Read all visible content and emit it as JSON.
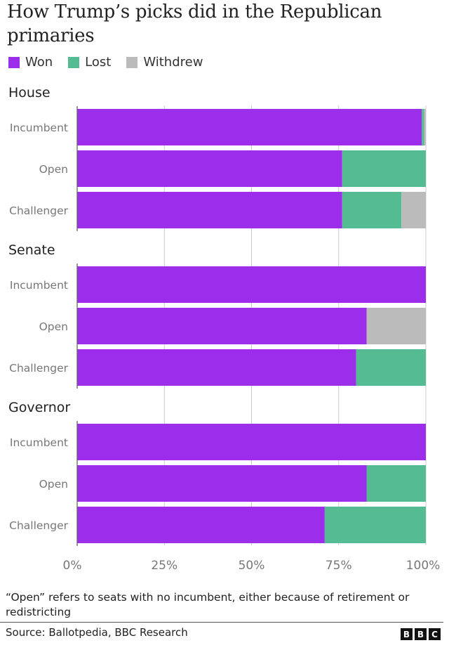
{
  "chart_data": {
    "type": "bar",
    "orientation": "horizontal",
    "stacked": true,
    "title": "How Trump’s picks did in the Republican primaries",
    "xlabel": "",
    "ylabel": "",
    "xlim": [
      0,
      100
    ],
    "x_ticks": [
      "0%",
      "25%",
      "50%",
      "75%",
      "100%"
    ],
    "x_tick_values": [
      0,
      25,
      50,
      75,
      100
    ],
    "grid": true,
    "legend_position": "top-left",
    "legend": [
      {
        "name": "Won",
        "color": "#9b2deb"
      },
      {
        "name": "Lost",
        "color": "#55bb92"
      },
      {
        "name": "Withdrew",
        "color": "#bbbbbb"
      }
    ],
    "groups": [
      {
        "name": "House",
        "categories": [
          "Incumbent",
          "Open",
          "Challenger"
        ],
        "series": [
          {
            "name": "Won",
            "values": [
              98.8,
              76,
              76
            ]
          },
          {
            "name": "Lost",
            "values": [
              0.7,
              24,
              17
            ]
          },
          {
            "name": "Withdrew",
            "values": [
              0.5,
              0,
              7
            ]
          }
        ]
      },
      {
        "name": "Senate",
        "categories": [
          "Incumbent",
          "Open",
          "Challenger"
        ],
        "series": [
          {
            "name": "Won",
            "values": [
              100,
              83,
              80
            ]
          },
          {
            "name": "Lost",
            "values": [
              0,
              0,
              20
            ]
          },
          {
            "name": "Withdrew",
            "values": [
              0,
              17,
              0
            ]
          }
        ]
      },
      {
        "name": "Governor",
        "categories": [
          "Incumbent",
          "Open",
          "Challenger"
        ],
        "series": [
          {
            "name": "Won",
            "values": [
              100,
              83,
              71
            ]
          },
          {
            "name": "Lost",
            "values": [
              0,
              17,
              29
            ]
          },
          {
            "name": "Withdrew",
            "values": [
              0,
              0,
              0
            ]
          }
        ]
      }
    ]
  },
  "footnote": "“Open” refers to seats with no incumbent, either because of retirement or redistricting",
  "source": "Source: Ballotpedia, BBC Research",
  "logo": [
    "B",
    "B",
    "C"
  ]
}
